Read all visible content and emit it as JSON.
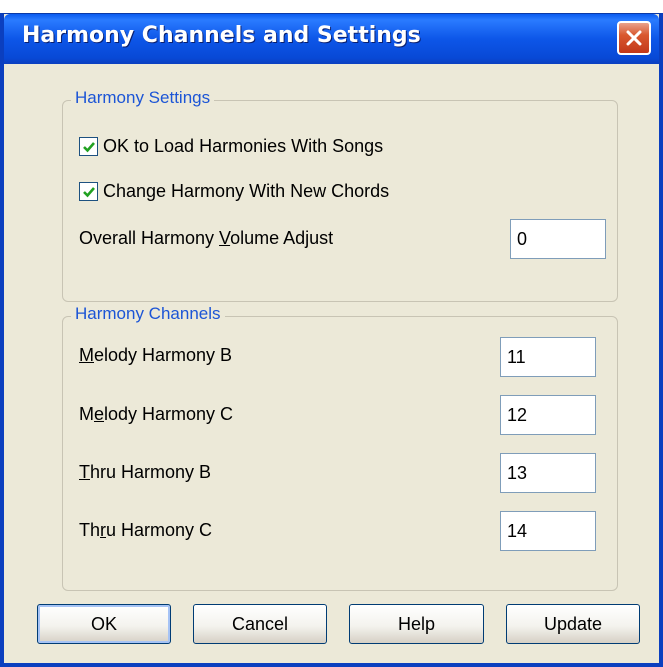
{
  "window": {
    "title": "Harmony Channels and Settings"
  },
  "settings_group": {
    "legend": "Harmony Settings",
    "load_with_songs": {
      "label": "OK to Load Harmonies With Songs",
      "checked": true
    },
    "change_with_chords": {
      "label": "Change Harmony With New Chords",
      "checked": true
    },
    "volume_adjust": {
      "label_pre": "Overall Harmony ",
      "label_key": "V",
      "label_post": "olume Adjust",
      "value": "0"
    }
  },
  "channels_group": {
    "legend": "Harmony Channels",
    "melody_b": {
      "label_pre": "",
      "label_key": "M",
      "label_post": "elody Harmony B",
      "value": "11"
    },
    "melody_c": {
      "label_pre": "M",
      "label_key": "e",
      "label_post": "lody Harmony C",
      "value": "12"
    },
    "thru_b": {
      "label_pre": "",
      "label_key": "T",
      "label_post": "hru Harmony B",
      "value": "13"
    },
    "thru_c": {
      "label_pre": "Th",
      "label_key": "r",
      "label_post": "u Harmony C",
      "value": "14"
    }
  },
  "buttons": {
    "ok": "OK",
    "cancel": "Cancel",
    "help": "Help",
    "update": "Update"
  },
  "colors": {
    "title_bar": "#0a5bf0",
    "dialog_bg": "#ece9d8",
    "group_legend": "#1c55d6",
    "close_button": "#d9582f"
  }
}
